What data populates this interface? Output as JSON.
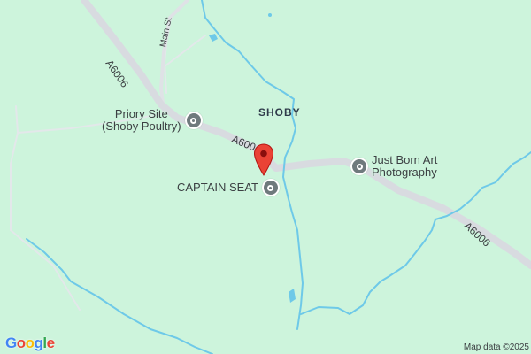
{
  "map": {
    "colors": {
      "land": "#cdf4dc",
      "road": "#d8dbe0",
      "water": "#6ec9e8",
      "marker": "#ea4335"
    },
    "roads": {
      "a6006_upper": "A6006",
      "a6006_mid": "A600",
      "a6006_lower": "A6006",
      "main_st": "Main St"
    },
    "place": "SHOBY",
    "pois": [
      {
        "line1": "Priory Site",
        "line2": "(Shoby Poultry)",
        "icon": "location-pin-icon"
      },
      {
        "line1": "CAPTAIN SEAT",
        "icon": "location-pin-icon"
      },
      {
        "line1": "Just Born Art",
        "line2": "Photography",
        "icon": "location-pin-icon"
      }
    ],
    "logo_letters": [
      {
        "ch": "G",
        "color": "#4285f4"
      },
      {
        "ch": "o",
        "color": "#ea4335"
      },
      {
        "ch": "o",
        "color": "#fbbc05"
      },
      {
        "ch": "g",
        "color": "#4285f4"
      },
      {
        "ch": "l",
        "color": "#34a853"
      },
      {
        "ch": "e",
        "color": "#ea4335"
      }
    ],
    "attribution": "Map data ©2025"
  }
}
